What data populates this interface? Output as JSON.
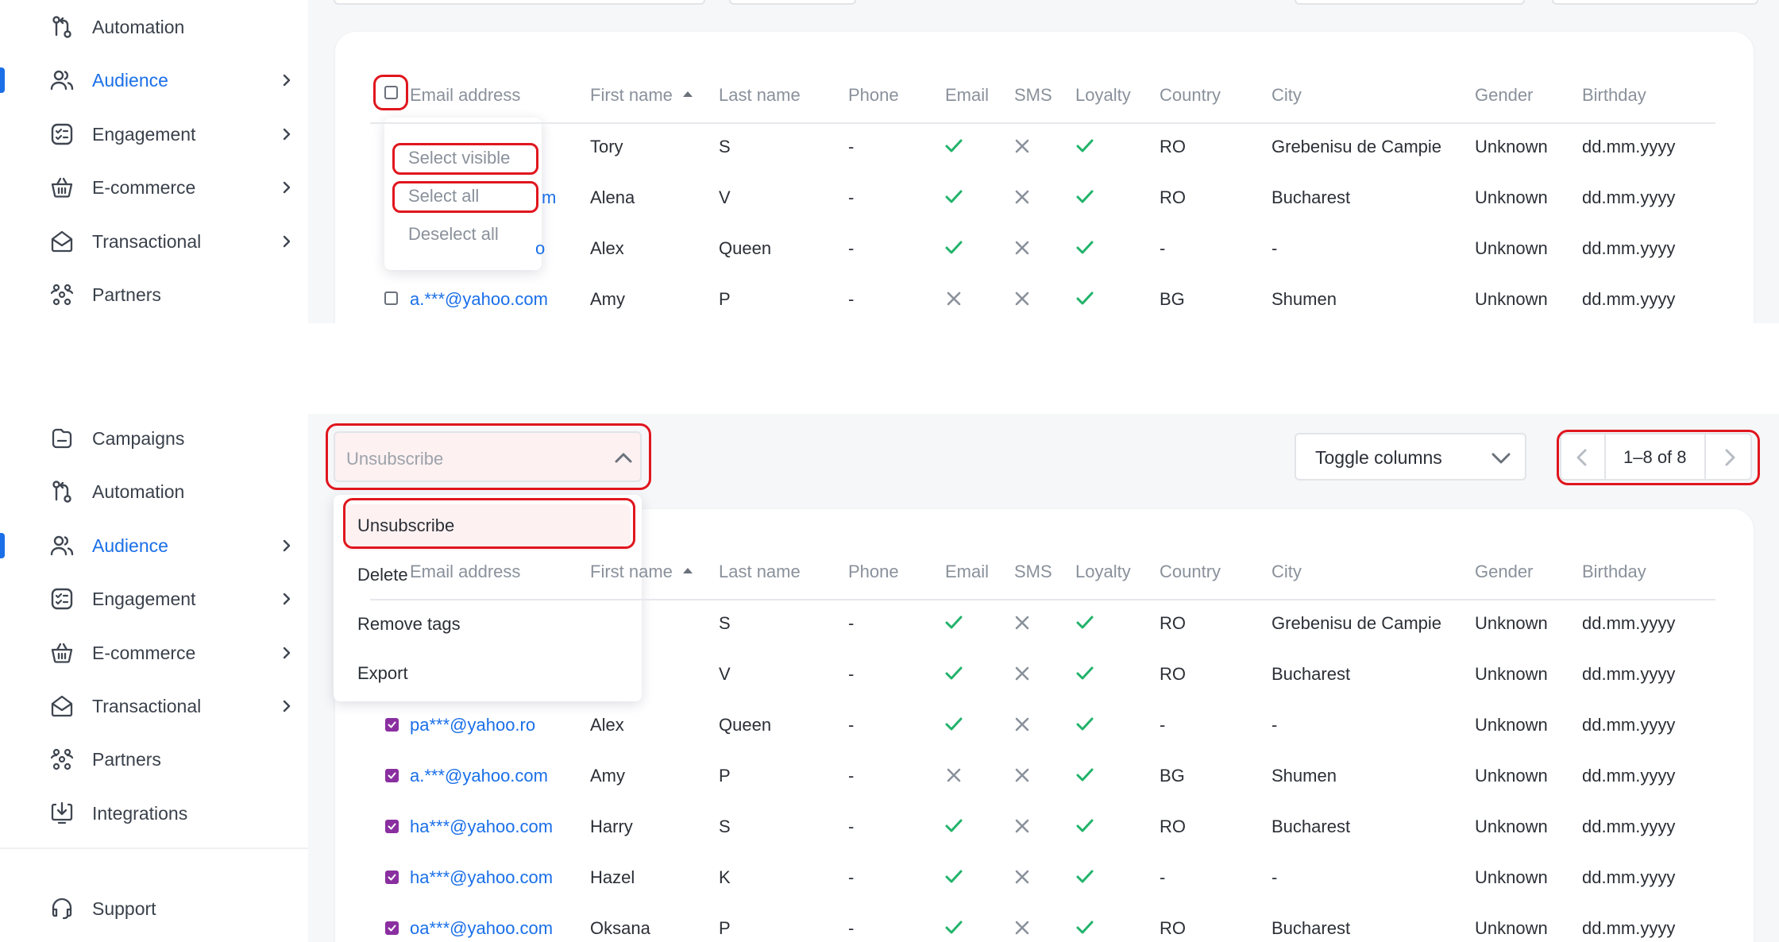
{
  "nav_top": [
    {
      "label": "Automation",
      "icon": "automation-icon",
      "chevron": false,
      "active": false
    },
    {
      "label": "Audience",
      "icon": "audience-icon",
      "chevron": true,
      "active": true
    },
    {
      "label": "Engagement",
      "icon": "engagement-icon",
      "chevron": true,
      "active": false
    },
    {
      "label": "E-commerce",
      "icon": "ecommerce-icon",
      "chevron": true,
      "active": false
    },
    {
      "label": "Transactional",
      "icon": "transactional-icon",
      "chevron": true,
      "active": false
    },
    {
      "label": "Partners",
      "icon": "partners-icon",
      "chevron": false,
      "active": false
    }
  ],
  "nav_bottom": [
    {
      "label": "Campaigns",
      "icon": "campaigns-icon",
      "chevron": false,
      "active": false
    },
    {
      "label": "Automation",
      "icon": "automation-icon",
      "chevron": false,
      "active": false
    },
    {
      "label": "Audience",
      "icon": "audience-icon",
      "chevron": true,
      "active": true
    },
    {
      "label": "Engagement",
      "icon": "engagement-icon",
      "chevron": true,
      "active": false
    },
    {
      "label": "E-commerce",
      "icon": "ecommerce-icon",
      "chevron": true,
      "active": false
    },
    {
      "label": "Transactional",
      "icon": "transactional-icon",
      "chevron": true,
      "active": false
    },
    {
      "label": "Partners",
      "icon": "partners-icon",
      "chevron": false,
      "active": false
    },
    {
      "label": "Integrations",
      "icon": "integrations-icon",
      "chevron": false,
      "active": false
    }
  ],
  "support": {
    "label": "Support",
    "icon": "support-icon"
  },
  "columns": [
    "Email address",
    "First name",
    "Last name",
    "Phone",
    "Email",
    "SMS",
    "Loyalty",
    "Country",
    "City",
    "Gender",
    "Birthday"
  ],
  "sort_indicator": "sort-asc-icon",
  "rows": [
    {
      "email": "",
      "first": "Tory",
      "last": "S",
      "phone": "-",
      "email_ok": true,
      "sms_ok": false,
      "loyalty_ok": true,
      "country": "RO",
      "city": "Grebenisu de Campie",
      "gender": "Unknown",
      "birthday": "dd.mm.yyyy"
    },
    {
      "email": "",
      "first": "Alena",
      "last": "V",
      "phone": "-",
      "email_ok": true,
      "sms_ok": false,
      "loyalty_ok": true,
      "country": "RO",
      "city": "Bucharest",
      "gender": "Unknown",
      "birthday": "dd.mm.yyyy"
    },
    {
      "email": "pa***@yahoo.ro",
      "first": "Alex",
      "last": "Queen",
      "phone": "-",
      "email_ok": true,
      "sms_ok": false,
      "loyalty_ok": true,
      "country": "-",
      "city": "-",
      "gender": "Unknown",
      "birthday": "dd.mm.yyyy"
    },
    {
      "email": "a.***@yahoo.com",
      "first": "Amy",
      "last": "P",
      "phone": "-",
      "email_ok": false,
      "sms_ok": false,
      "loyalty_ok": true,
      "country": "BG",
      "city": "Shumen",
      "gender": "Unknown",
      "birthday": "dd.mm.yyyy"
    },
    {
      "email": "ha***@yahoo.com",
      "first": "Harry",
      "last": "S",
      "phone": "-",
      "email_ok": true,
      "sms_ok": false,
      "loyalty_ok": true,
      "country": "RO",
      "city": "Bucharest",
      "gender": "Unknown",
      "birthday": "dd.mm.yyyy"
    },
    {
      "email": "ha***@yahoo.com",
      "first": "Hazel",
      "last": "K",
      "phone": "-",
      "email_ok": true,
      "sms_ok": false,
      "loyalty_ok": true,
      "country": "-",
      "city": "-",
      "gender": "Unknown",
      "birthday": "dd.mm.yyyy"
    },
    {
      "email": "oa***@yahoo.com",
      "first": "Oksana",
      "last": "P",
      "phone": "-",
      "email_ok": true,
      "sms_ok": false,
      "loyalty_ok": true,
      "country": "RO",
      "city": "Bucharest",
      "gender": "Unknown",
      "birthday": "dd.mm.yyyy"
    }
  ],
  "top_email_fragments": {
    "row2": "m",
    "row3": "o"
  },
  "select_menu": {
    "items": [
      "Select visible",
      "Select all",
      "Deselect all"
    ]
  },
  "bulk_action": {
    "placeholder": "Unsubscribe",
    "options": [
      "Unsubscribe",
      "Delete",
      "Remove tags",
      "Export"
    ]
  },
  "toggle_columns": {
    "label": "Toggle columns"
  },
  "pagination": {
    "label": "1–8 of 8"
  },
  "colors": {
    "accent": "#1a6fe8",
    "check": "#22b36b",
    "cross": "#8a919b",
    "highlight": "#e0161e",
    "checkbox_on": "#8a2fa0"
  }
}
